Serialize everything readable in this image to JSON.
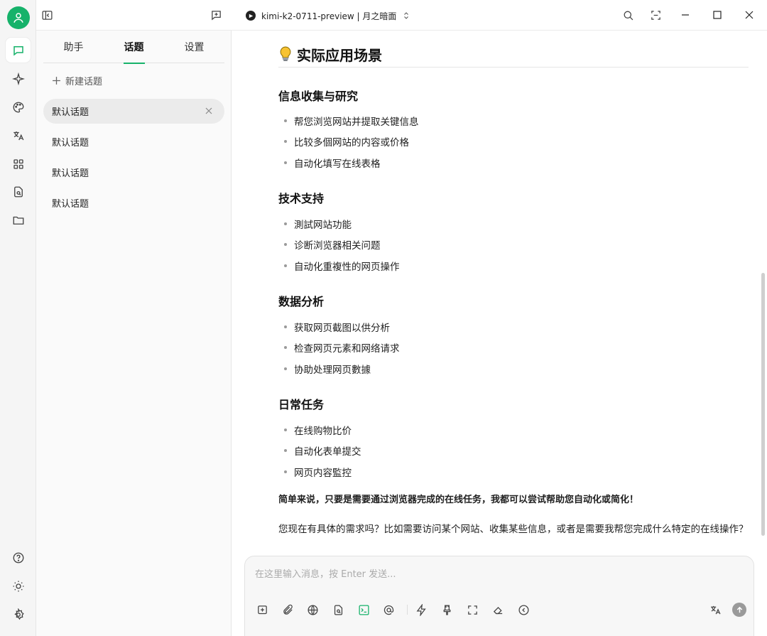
{
  "topbar": {
    "model_label": "kimi-k2-0711-preview | 月之暗面"
  },
  "sidebar": {
    "tabs": [
      {
        "label": "助手"
      },
      {
        "label": "话题"
      },
      {
        "label": "设置"
      }
    ],
    "new_topic_label": "新建话题",
    "topics": [
      {
        "label": "默认话题"
      },
      {
        "label": "默认话题"
      },
      {
        "label": "默认话题"
      },
      {
        "label": "默认话题"
      }
    ]
  },
  "main": {
    "heading": "实际应用场景",
    "sections": [
      {
        "title": "信息收集与研究",
        "items": [
          "帮您浏览网站并提取关键信息",
          "比较多個网站的内容或价格",
          "自动化填写在线表格"
        ]
      },
      {
        "title": "技术支持",
        "items": [
          "測試网站功能",
          "诊断浏览器相关问题",
          "自动化重複性的网页操作"
        ]
      },
      {
        "title": "数据分析",
        "items": [
          "获取网页截图以供分析",
          "检查网页元素和网络请求",
          "协助处理网页數據"
        ]
      },
      {
        "title": "日常任务",
        "items": [
          "在线购物比价",
          "自动化表单提交",
          "网页内容監控"
        ]
      }
    ],
    "summary": "简单来说，只要是需要通过浏览器完成的在线任务，我都可以尝试帮助您自动化或简化！",
    "question": "您现在有具体的需求吗？比如需要访问某个网站、收集某些信息，或者是需要我帮您完成什么特定的在线操作？"
  },
  "composer": {
    "placeholder": "在这里输入消息，按 Enter 发送..."
  },
  "colors": {
    "accent": "#16b26a"
  }
}
